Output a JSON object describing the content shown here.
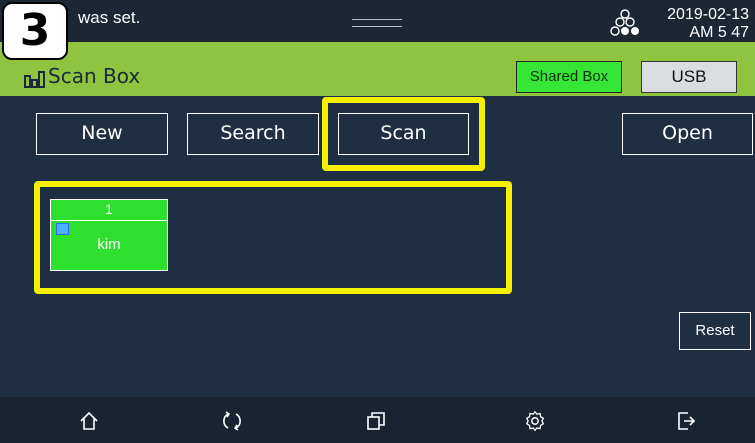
{
  "step_badge": "3",
  "status": {
    "message": "was set.",
    "date": "2019-02-13",
    "time": "AM 5 47"
  },
  "title": {
    "text": "Scan Box",
    "shared_box_label": "Shared Box",
    "usb_label": "USB"
  },
  "toolbar": {
    "new_label": "New",
    "search_label": "Search",
    "scan_label": "Scan",
    "open_label": "Open"
  },
  "boxes": [
    {
      "number": "1",
      "name": "kim",
      "locked": true
    }
  ],
  "reset_label": "Reset",
  "nav_icons": [
    "home-icon",
    "refresh-icon",
    "window-switch-icon",
    "settings-icon",
    "logout-icon"
  ],
  "colors": {
    "title_bar": "#8fc440",
    "shared_box": "#35e635",
    "highlight": "#f5f000",
    "background": "#1e2f44"
  }
}
